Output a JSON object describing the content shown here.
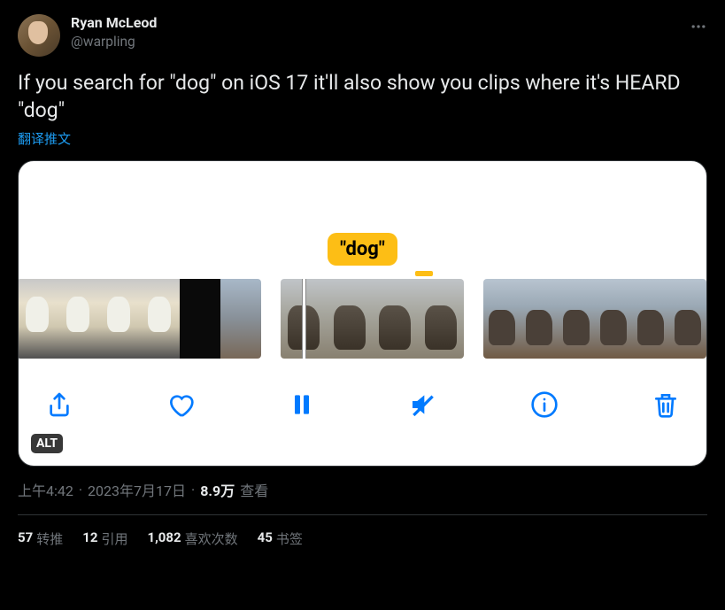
{
  "author": {
    "display_name": "Ryan McLeod",
    "handle": "@warpling"
  },
  "tweet_text": "If you search for \"dog\" on iOS 17 it'll also show you clips where it's HEARD \"dog\"",
  "translate_label": "翻译推文",
  "media": {
    "keyword_label": "\"dog\"",
    "alt_badge": "ALT"
  },
  "meta": {
    "time": "上午4:42",
    "dot1": "·",
    "date": "2023年7月17日",
    "dot2": "·",
    "views_count": "8.9万",
    "views_label": "查看"
  },
  "stats": {
    "retweets": {
      "count": "57",
      "label": "转推"
    },
    "quotes": {
      "count": "12",
      "label": "引用"
    },
    "likes": {
      "count": "1,082",
      "label": "喜欢次数"
    },
    "bookmarks": {
      "count": "45",
      "label": "书签"
    }
  }
}
